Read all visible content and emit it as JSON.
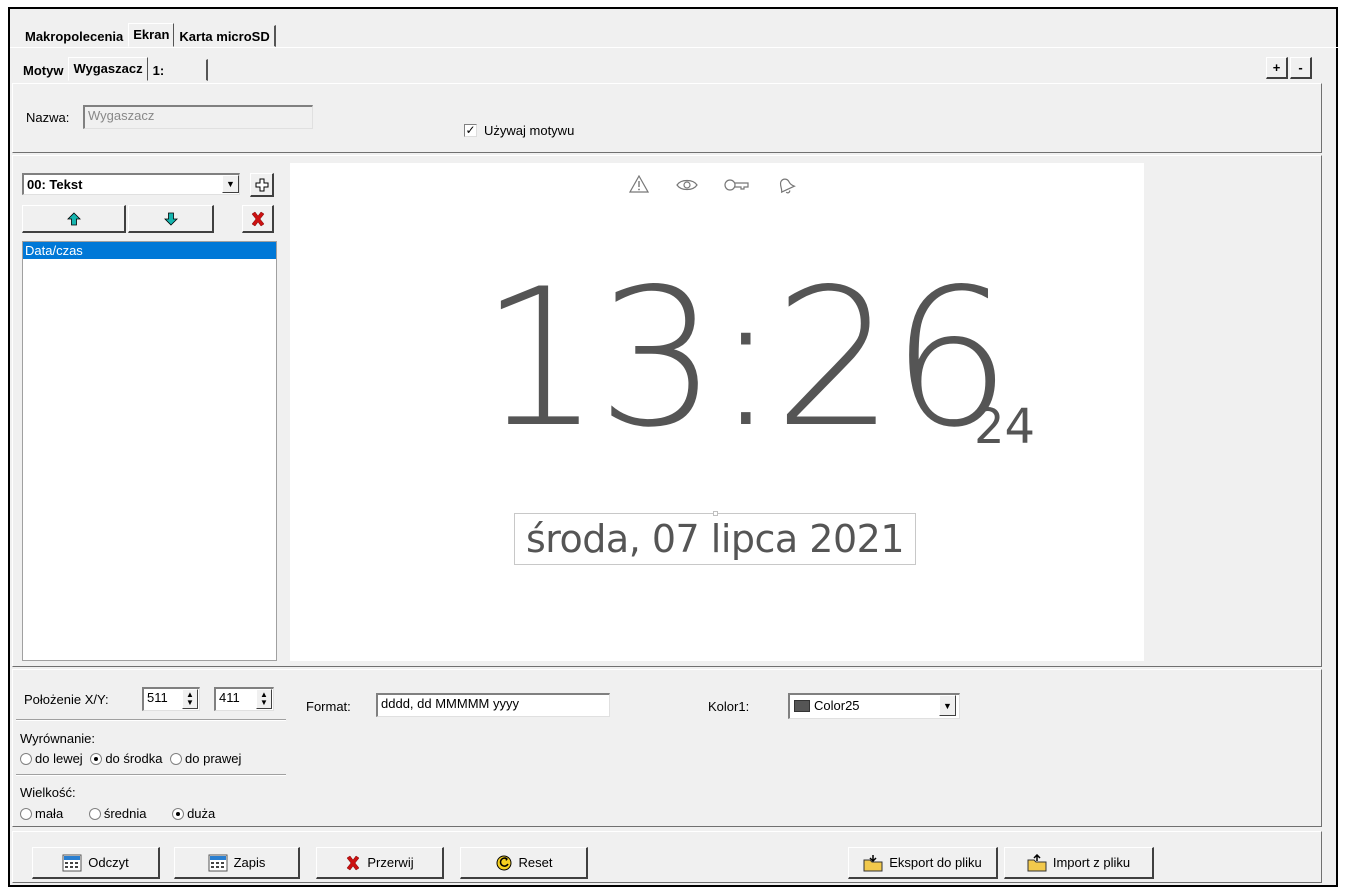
{
  "main_tabs": [
    "Makropolecenia",
    "Ekran",
    "Karta microSD"
  ],
  "sub_tabs": [
    "Motyw",
    "Wygaszacz",
    "1:"
  ],
  "plus_label": "+",
  "minus_label": "-",
  "name_label": "Nazwa:",
  "name_value": "Wygaszacz",
  "use_theme_label": "Używaj motywu",
  "use_theme_checked": true,
  "element_select_value": "00: Tekst",
  "element_list": [
    "Data/czas"
  ],
  "preview": {
    "status_icons": [
      "warning-icon",
      "eye-icon",
      "key-icon",
      "bell-icon"
    ],
    "time": "13:26",
    "seconds": "24",
    "date": "środa, 07 lipca 2021"
  },
  "position_label": "Położenie X/Y:",
  "position_x": "511",
  "position_y": "411",
  "format_label": "Format:",
  "format_value": "dddd, dd MMMMM yyyy",
  "color_label": "Kolor1:",
  "color_value": "Color25",
  "color_swatch": "#555555",
  "alignment": {
    "label": "Wyrównanie:",
    "options": [
      "do lewej",
      "do środka",
      "do prawej"
    ],
    "selected": 1
  },
  "size": {
    "label": "Wielkość:",
    "options": [
      "mała",
      "średnia",
      "duża"
    ],
    "selected": 2
  },
  "buttons": {
    "read": "Odczyt",
    "write": "Zapis",
    "abort": "Przerwij",
    "reset": "Reset",
    "export": "Eksport do pliku",
    "import": "Import z pliku"
  }
}
